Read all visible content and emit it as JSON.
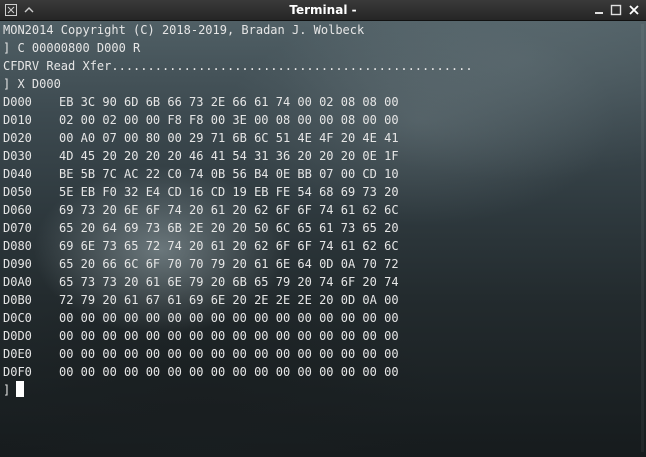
{
  "window": {
    "title": "Terminal -"
  },
  "terminal": {
    "header_lines": [
      "MON2014 Copyright (C) 2018-2019, Bradan J. Wolbeck",
      "] C 00000800 D000 R",
      "CFDRV Read Xfer..................................................",
      "] X D000"
    ],
    "dump_rows": [
      {
        "addr": "D000",
        "bytes": "EB 3C 90 6D 6B 66 73 2E 66 61 74 00 02 08 08 00"
      },
      {
        "addr": "D010",
        "bytes": "02 00 02 00 00 F8 F8 00 3E 00 08 00 00 08 00 00"
      },
      {
        "addr": "D020",
        "bytes": "00 A0 07 00 80 00 29 71 6B 6C 51 4E 4F 20 4E 41"
      },
      {
        "addr": "D030",
        "bytes": "4D 45 20 20 20 20 46 41 54 31 36 20 20 20 0E 1F"
      },
      {
        "addr": "D040",
        "bytes": "BE 5B 7C AC 22 C0 74 0B 56 B4 0E BB 07 00 CD 10"
      },
      {
        "addr": "D050",
        "bytes": "5E EB F0 32 E4 CD 16 CD 19 EB FE 54 68 69 73 20"
      },
      {
        "addr": "D060",
        "bytes": "69 73 20 6E 6F 74 20 61 20 62 6F 6F 74 61 62 6C"
      },
      {
        "addr": "D070",
        "bytes": "65 20 64 69 73 6B 2E 20 20 50 6C 65 61 73 65 20"
      },
      {
        "addr": "D080",
        "bytes": "69 6E 73 65 72 74 20 61 20 62 6F 6F 74 61 62 6C"
      },
      {
        "addr": "D090",
        "bytes": "65 20 66 6C 6F 70 70 79 20 61 6E 64 0D 0A 70 72"
      },
      {
        "addr": "D0A0",
        "bytes": "65 73 73 20 61 6E 79 20 6B 65 79 20 74 6F 20 74"
      },
      {
        "addr": "D0B0",
        "bytes": "72 79 20 61 67 61 69 6E 20 2E 2E 2E 20 0D 0A 00"
      },
      {
        "addr": "D0C0",
        "bytes": "00 00 00 00 00 00 00 00 00 00 00 00 00 00 00 00"
      },
      {
        "addr": "D0D0",
        "bytes": "00 00 00 00 00 00 00 00 00 00 00 00 00 00 00 00"
      },
      {
        "addr": "D0E0",
        "bytes": "00 00 00 00 00 00 00 00 00 00 00 00 00 00 00 00"
      },
      {
        "addr": "D0F0",
        "bytes": "00 00 00 00 00 00 00 00 00 00 00 00 00 00 00 00"
      }
    ],
    "prompt": "]"
  },
  "icons": {
    "menu": "window-menu-icon",
    "shade": "shade-icon",
    "minimize": "minimize-icon",
    "maximize": "maximize-icon",
    "close": "close-icon"
  },
  "colors": {
    "text": "#e6e6e6",
    "titlebar": "#2e2e2e",
    "cursor": "#ffffff"
  }
}
